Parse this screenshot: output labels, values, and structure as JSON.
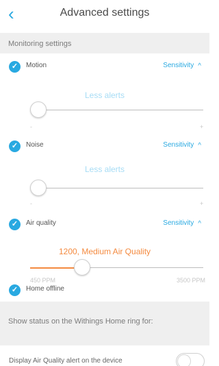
{
  "header": {
    "back_icon": "chevron-left-icon",
    "title": "Advanced settings"
  },
  "monitoring": {
    "section_label": "Monitoring settings",
    "items": [
      {
        "label": "Motion",
        "checked": true,
        "action": "Sensitivity",
        "slider_caption": "Less alerts",
        "min": "-",
        "max": "+",
        "value_fraction": 0.04
      },
      {
        "label": "Noise",
        "checked": true,
        "action": "Sensitivity",
        "slider_caption": "Less alerts",
        "min": "-",
        "max": "+",
        "value_fraction": 0.04
      },
      {
        "label": "Air quality",
        "checked": true,
        "action": "Sensitivity",
        "slider_caption": "1200, Medium Air Quality",
        "min": "450 PPM",
        "max": "3500 PPM",
        "value_fraction": 0.3
      }
    ],
    "home_offline": {
      "label": "Home offline",
      "checked": true
    }
  },
  "ring": {
    "section_label": "Show status on the Withings Home ring for:",
    "device_alert": {
      "label": "Display Air Quality alert on the device",
      "enabled": false
    }
  },
  "colors": {
    "accent": "#29a9e1",
    "air_quality": "#f48a3f",
    "caption_light": "#a6dcf5"
  }
}
